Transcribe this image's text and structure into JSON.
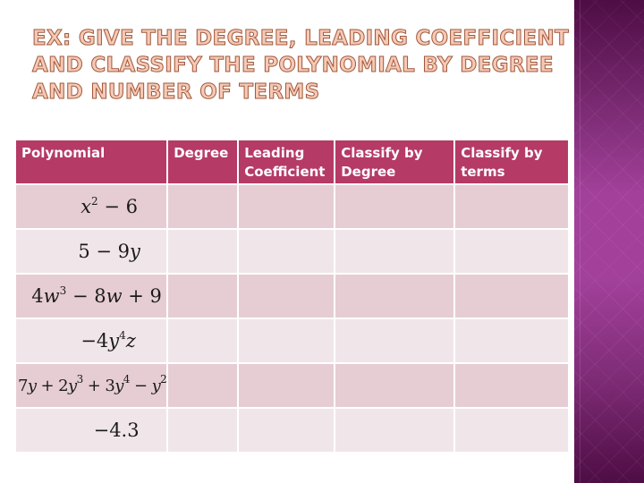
{
  "title": {
    "lines": [
      "EX:  GIVE THE DEGREE, LEADING COEFFICIENT",
      "AND CLASSIFY THE POLYNOMIAL BY DEGREE",
      "AND NUMBER OF TERMS"
    ]
  },
  "colors": {
    "header_bg": "#b53a66",
    "row_odd_bg": "#e6cdd3",
    "row_even_bg": "#f0e6ea",
    "sidebar_mid": "#a2409a",
    "sidebar_dark": "#4e0d44",
    "title_fill": "#f6c9b6"
  },
  "table": {
    "headers": [
      "Polynomial",
      "Degree",
      "Leading Coefficient",
      "Classify by Degree",
      "Classify by terms"
    ],
    "rows": [
      {
        "polynomial": "x^2 − 6",
        "degree": "",
        "leading_coefficient": "",
        "classify_degree": "",
        "classify_terms": ""
      },
      {
        "polynomial": "5 − 9y",
        "degree": "",
        "leading_coefficient": "",
        "classify_degree": "",
        "classify_terms": ""
      },
      {
        "polynomial": "4w^3 − 8w + 9",
        "degree": "",
        "leading_coefficient": "",
        "classify_degree": "",
        "classify_terms": ""
      },
      {
        "polynomial": "−4y^4z",
        "degree": "",
        "leading_coefficient": "",
        "classify_degree": "",
        "classify_terms": ""
      },
      {
        "polynomial": "7y + 2y^3 + 3y^4 − y^2",
        "degree": "",
        "leading_coefficient": "",
        "classify_degree": "",
        "classify_terms": ""
      },
      {
        "polynomial": "−4.3",
        "degree": "",
        "leading_coefficient": "",
        "classify_degree": "",
        "classify_terms": ""
      }
    ]
  },
  "expressions": {
    "r0": {
      "a": "x",
      "a_exp": "2",
      "b": " − 6"
    },
    "r1": {
      "a": "5 − 9",
      "b": "y"
    },
    "r2": {
      "a": "4",
      "b": "w",
      "b_exp": "3",
      "c": " − 8",
      "d": "w",
      "e": " + 9"
    },
    "r3": {
      "a": "−4",
      "b": "y",
      "b_exp": "4",
      "c": "z"
    },
    "r4": {
      "a": "7",
      "b": "y",
      "c": " + 2",
      "d": "y",
      "d_exp": "3",
      "e": " + 3",
      "f": "y",
      "f_exp": "4",
      "g": " − ",
      "h": "y",
      "h_exp": "2"
    },
    "r5": {
      "a": "−4.3"
    }
  }
}
